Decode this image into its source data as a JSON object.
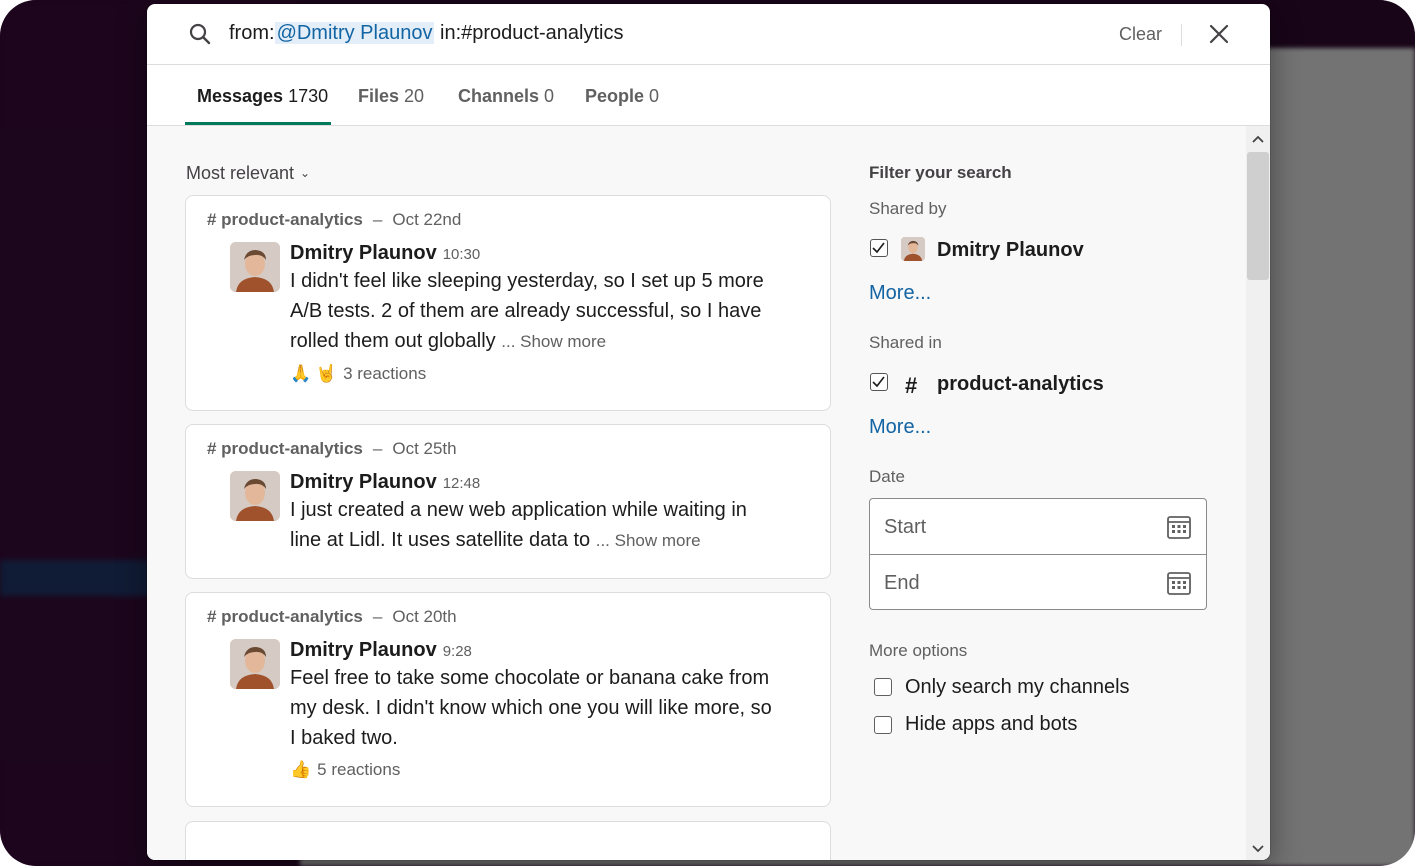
{
  "search": {
    "prefix": "from:",
    "user_token": "@Dmitry Plaunov",
    "suffix": " in:#product-analytics",
    "clear_label": "Clear"
  },
  "tabs": [
    {
      "label": "Messages",
      "count": "1730"
    },
    {
      "label": "Files",
      "count": "20"
    },
    {
      "label": "Channels",
      "count": "0"
    },
    {
      "label": "People",
      "count": "0"
    }
  ],
  "sort_label": "Most relevant",
  "messages": [
    {
      "channel": "# product-analytics",
      "dash": "–",
      "date": "Oct 22nd",
      "author": "Dmitry Plaunov",
      "time": "10:30",
      "lines": [
        "I didn't feel like sleeping yesterday, so I set up  5  more",
        " A/B tests. 2 of them are already successful, so I have",
        "rolled them out globally"
      ],
      "show_more": "... Show more",
      "reactions_emoji": "🙏 🤘",
      "reactions": "3 reactions"
    },
    {
      "channel": "# product-analytics",
      "dash": "–",
      "date": "Oct 25th",
      "author": "Dmitry Plaunov",
      "time": "12:48",
      "lines": [
        "I just created a new web application while waiting in",
        "line at Lidl. It uses satellite data to "
      ],
      "show_more": "... Show more"
    },
    {
      "channel": "# product-analytics",
      "dash": "–",
      "date": "Oct 20th",
      "author": "Dmitry Plaunov",
      "time": "9:28",
      "lines": [
        "Feel free to take some chocolate or banana cake from",
        "my desk. I didn't know which one you will like more, so",
        "I baked two."
      ],
      "reactions_emoji": "👍",
      "reactions": "5 reactions"
    }
  ],
  "filters": {
    "title": "Filter your search",
    "shared_by_label": "Shared by",
    "shared_by_value": "Dmitry Plaunov",
    "more_1": "More...",
    "shared_in_label": "Shared in",
    "shared_in_hash": "#",
    "shared_in_value": "product-analytics",
    "more_2": "More...",
    "date_label": "Date",
    "start_placeholder": "Start",
    "end_placeholder": "End",
    "more_options_label": "More options",
    "opt_my_channels": "Only search my channels",
    "opt_hide_bots": "Hide apps and bots"
  },
  "colors": {
    "accent_green": "#007a5a",
    "link_blue": "#1264a3",
    "sidebar_purple": "#3f0e40"
  }
}
